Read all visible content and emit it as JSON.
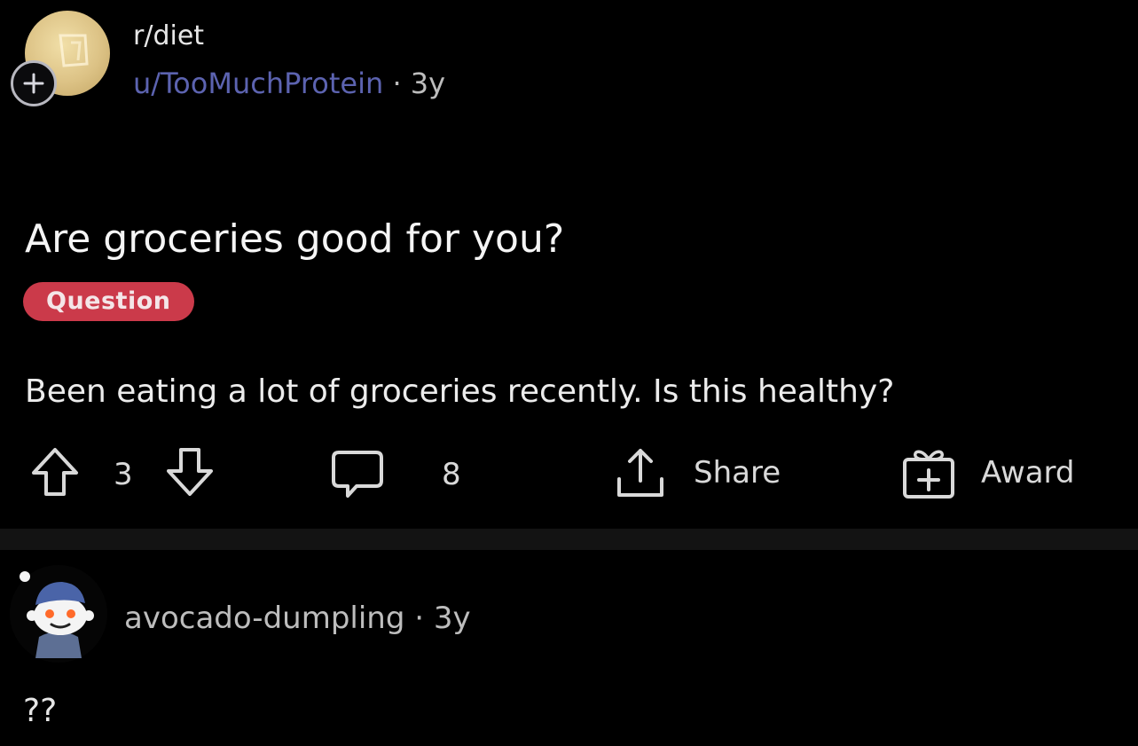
{
  "post": {
    "subreddit": "r/diet",
    "author": "u/TooMuchProtein",
    "separator": "·",
    "age": "3y",
    "title": "Are groceries good for you?",
    "flair": "Question",
    "body": "Been eating a lot of groceries recently. Is this healthy?",
    "flair_color": "#cb3a4a",
    "author_color": "#5c63b0"
  },
  "actions": {
    "vote_count": "3",
    "comment_count": "8",
    "share_label": "Share",
    "award_label": "Award"
  },
  "icons": {
    "join": "plus-icon",
    "upvote": "arrow-up-icon",
    "downvote": "arrow-down-icon",
    "comment": "speech-bubble-icon",
    "share": "share-icon",
    "award": "gift-icon"
  },
  "comment": {
    "author": "avocado-dumpling",
    "separator": "·",
    "age": "3y",
    "body": "??"
  }
}
